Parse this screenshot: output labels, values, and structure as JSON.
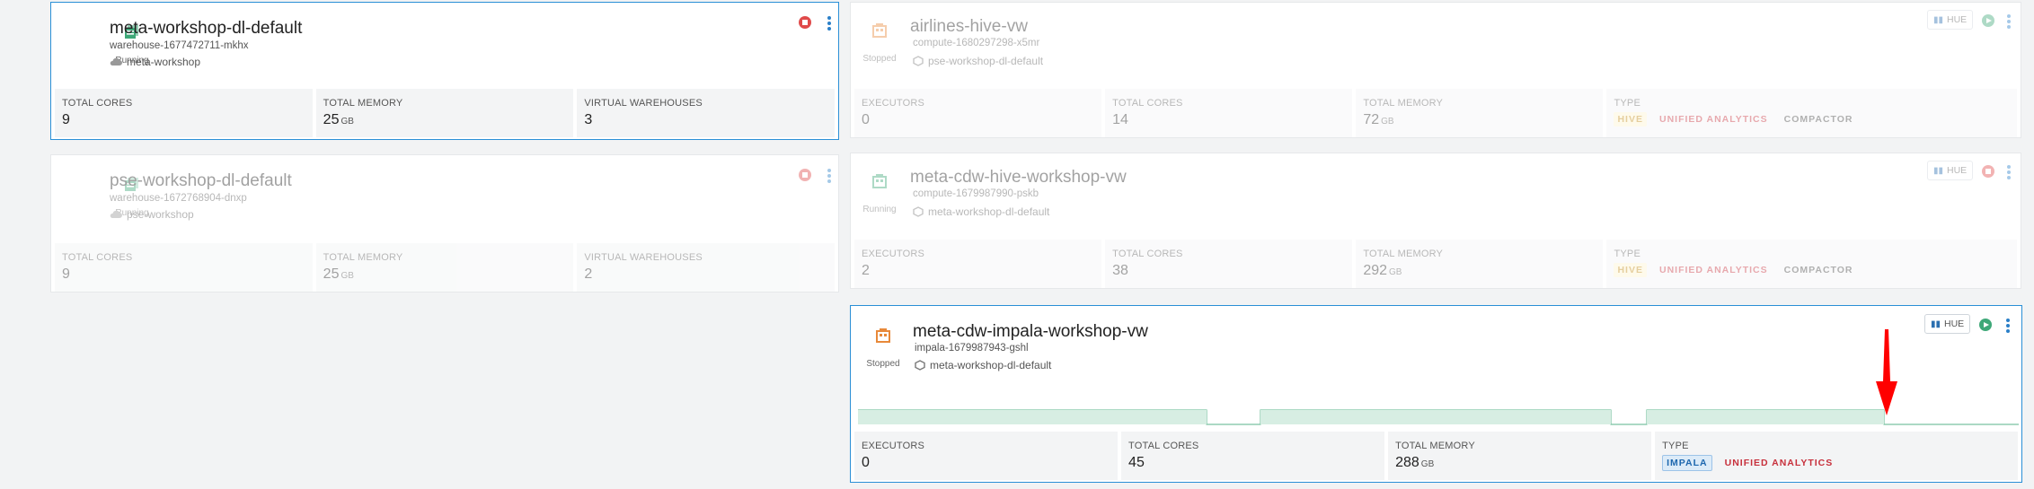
{
  "labels": {
    "executors": "EXECUTORS",
    "total_cores": "TOTAL CORES",
    "total_memory": "TOTAL MEMORY",
    "virtual_warehouses": "VIRTUAL WAREHOUSES",
    "type": "TYPE",
    "gb": "GB",
    "hue": "HUE"
  },
  "colors": {
    "selected_border": "#2a8fd6",
    "running_green": "#3ea878",
    "stopped_orange": "#e8893a",
    "stop_red": "#e04a4a",
    "chart_fill": "#d7eee3",
    "chart_line": "#79c2a1",
    "arrow": "#ff0000"
  },
  "environments": [
    {
      "name": "meta-workshop-dl-default",
      "id": "warehouse-1677472711-mkhx",
      "cloud": "meta-workshop",
      "status": "Running",
      "icon": "environment-stack-icon",
      "total_cores": "9",
      "total_memory": "25",
      "virtual_warehouses": "3"
    },
    {
      "name": "pse-workshop-dl-default",
      "id": "warehouse-1672768904-dnxp",
      "cloud": "pse-workshop",
      "status": "Running",
      "icon": "environment-stack-icon",
      "total_cores": "9",
      "total_memory": "25",
      "virtual_warehouses": "2"
    }
  ],
  "warehouses": [
    {
      "name": "airlines-hive-vw",
      "id": "compute-1680297298-x5mr",
      "env": "pse-workshop-dl-default",
      "status": "Stopped",
      "executors": "0",
      "total_cores": "14",
      "total_memory": "72",
      "tags": [
        "HIVE",
        "UNIFIED ANALYTICS",
        "COMPACTOR"
      ]
    },
    {
      "name": "meta-cdw-hive-workshop-vw",
      "id": "compute-1679987990-pskb",
      "env": "meta-workshop-dl-default",
      "status": "Running",
      "executors": "2",
      "total_cores": "38",
      "total_memory": "292",
      "tags": [
        "HIVE",
        "UNIFIED ANALYTICS",
        "COMPACTOR"
      ]
    },
    {
      "name": "meta-cdw-impala-workshop-vw",
      "id": "impala-1679987943-gshl",
      "env": "meta-workshop-dl-default",
      "status": "Stopped",
      "executors": "0",
      "total_cores": "45",
      "total_memory": "288",
      "tags": [
        "IMPALA",
        "UNIFIED ANALYTICS"
      ]
    }
  ]
}
